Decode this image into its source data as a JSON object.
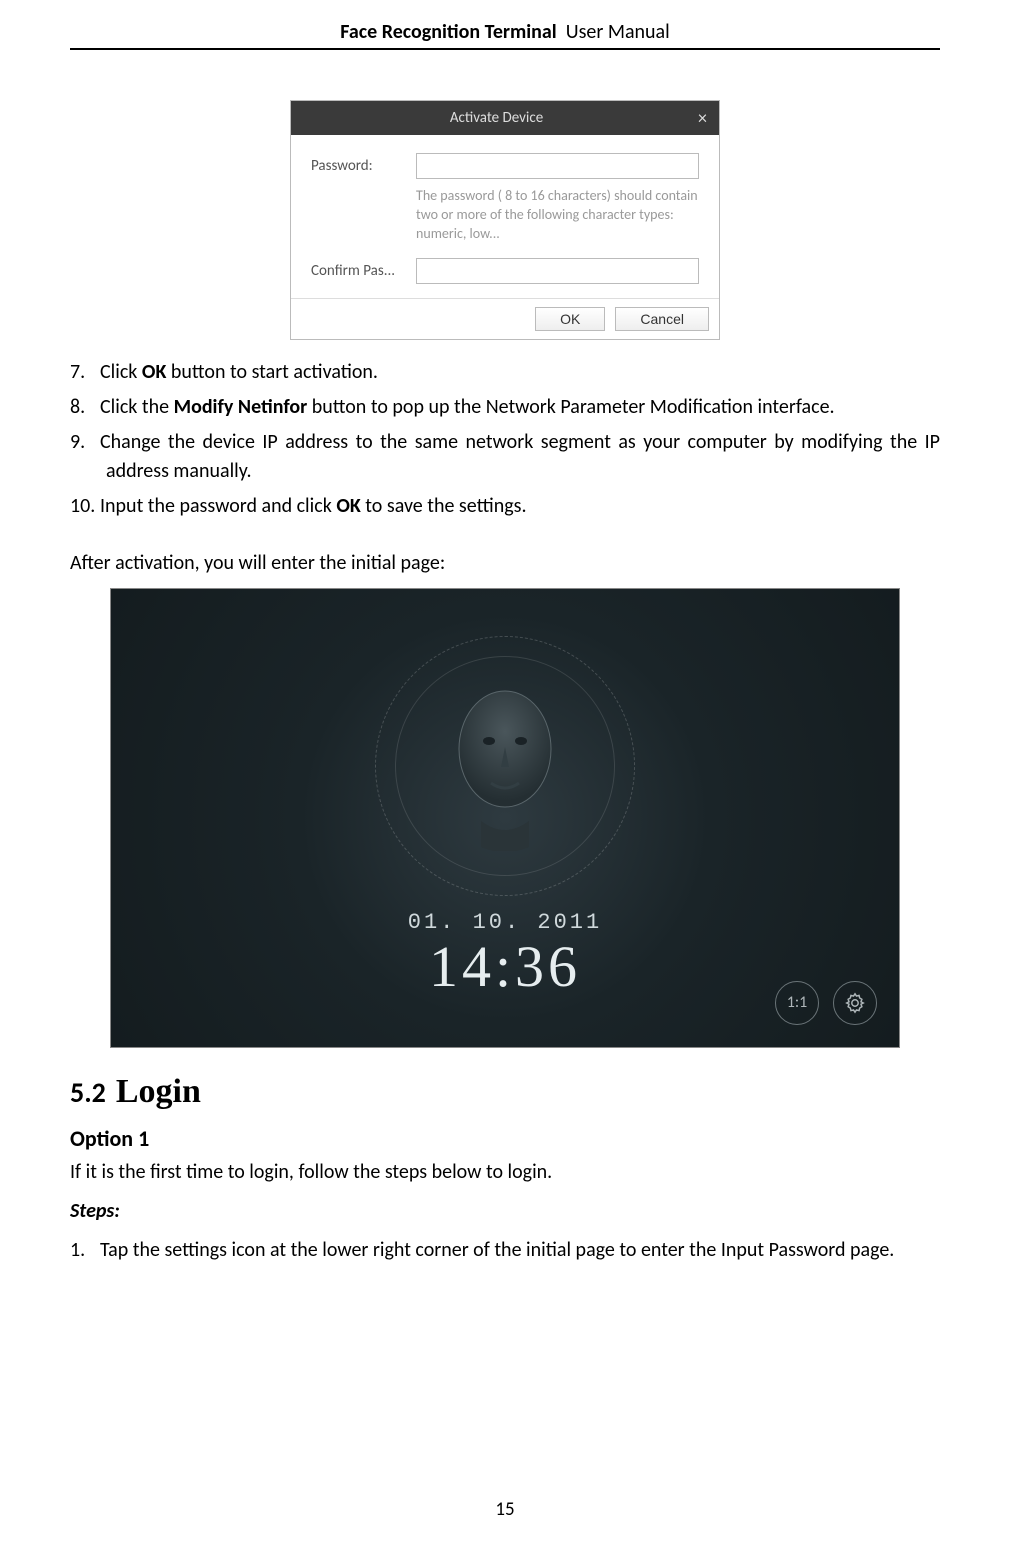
{
  "header": {
    "bold": "Face Recognition Terminal",
    "rest": "User Manual"
  },
  "dialog": {
    "title": "Activate Device",
    "password_label": "Password:",
    "password_value": "",
    "hint": "The password ( 8 to 16 characters) should contain two or more of the following character types: numeric, low...",
    "confirm_label": "Confirm Pas...",
    "confirm_value": "",
    "ok": "OK",
    "cancel": "Cancel"
  },
  "steps_first": [
    {
      "n": "7.",
      "pre": "Click ",
      "bold": "OK",
      "post": " button to start activation."
    },
    {
      "n": "8.",
      "pre": "Click the ",
      "bold": "Modify Netinfor",
      "post": " button to pop up the Network Parameter Modification interface."
    },
    {
      "n": "9.",
      "pre": "",
      "bold": "",
      "post": "Change the device IP address to the same network segment as your computer by modifying the IP address manually.",
      "justify": true
    },
    {
      "n": "10.",
      "pre": "Input the password and click ",
      "bold": "OK",
      "post": " to save the settings."
    }
  ],
  "after_activation": "After activation, you will enter the initial page:",
  "screen": {
    "date": "01. 10. 2011",
    "time": "14:36",
    "ratio_label": "1:1"
  },
  "section": {
    "num": "5.2",
    "title": "Login"
  },
  "option1": {
    "heading": "Option 1",
    "intro": "If it is the first time to login, follow the steps below to login.",
    "steps_label": "Steps:",
    "steps": [
      {
        "n": "1.",
        "text": "Tap the settings icon at the lower right corner of the initial page to enter the Input Password page."
      }
    ]
  },
  "page_number": "15"
}
